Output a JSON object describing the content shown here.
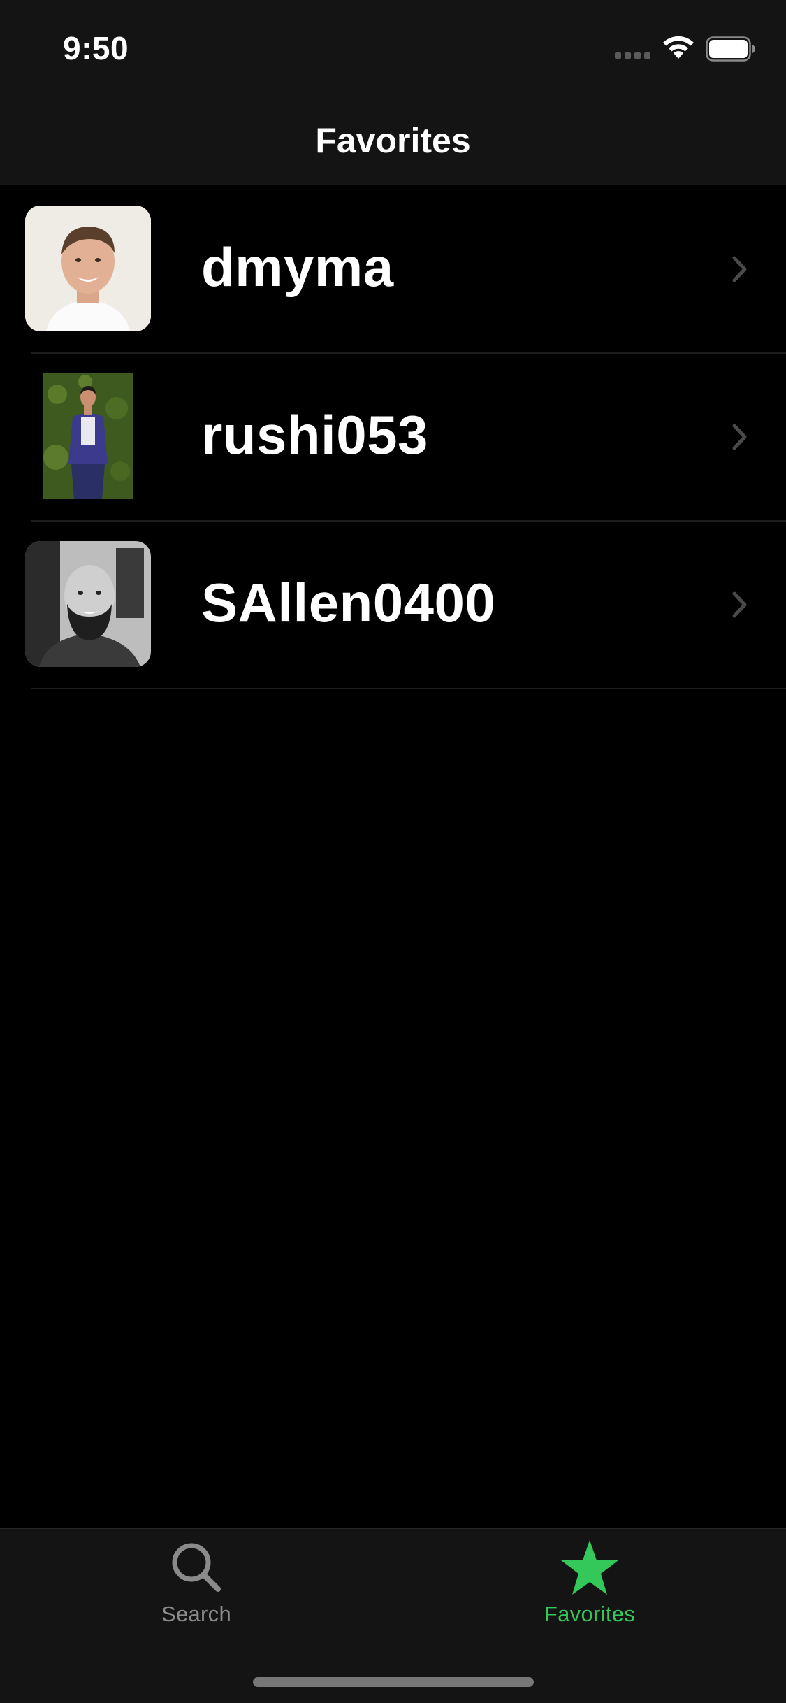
{
  "status_bar": {
    "time": "9:50"
  },
  "nav": {
    "title": "Favorites"
  },
  "favorites": [
    {
      "username": "dmyma"
    },
    {
      "username": "rushi053"
    },
    {
      "username": "SAllen0400"
    }
  ],
  "tab_bar": {
    "tabs": [
      {
        "label": "Search",
        "icon": "search-icon",
        "selected": false
      },
      {
        "label": "Favorites",
        "icon": "star-icon",
        "selected": true
      }
    ]
  },
  "colors": {
    "accent": "#34c759",
    "background": "#000000",
    "chrome": "#141414",
    "inactive": "#8a8a8a"
  }
}
